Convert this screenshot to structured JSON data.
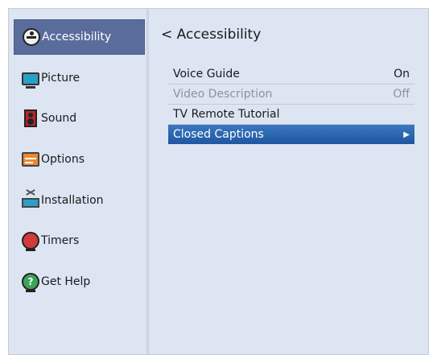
{
  "sidebar": {
    "items": [
      {
        "label": "Accessibility",
        "icon": "accessibility-icon",
        "active": true
      },
      {
        "label": "Picture",
        "icon": "picture-icon",
        "active": false
      },
      {
        "label": "Sound",
        "icon": "sound-icon",
        "active": false
      },
      {
        "label": "Options",
        "icon": "options-icon",
        "active": false
      },
      {
        "label": "Installation",
        "icon": "installation-icon",
        "active": false
      },
      {
        "label": "Timers",
        "icon": "timers-icon",
        "active": false
      },
      {
        "label": "Get Help",
        "icon": "help-icon",
        "active": false
      }
    ]
  },
  "main": {
    "back_glyph": "<",
    "title": "Accessibility",
    "menu": [
      {
        "label": "Voice Guide",
        "value": "On",
        "state": "normal"
      },
      {
        "label": "Video Description",
        "value": "Off",
        "state": "disabled"
      },
      {
        "label": "TV Remote Tutorial",
        "value": "",
        "state": "normal"
      },
      {
        "label": "Closed Captions",
        "value": "",
        "state": "selected",
        "arrow": "▶"
      }
    ]
  },
  "colors": {
    "background": "#dde5f3",
    "sidebar_active": "#5a6c9c",
    "selection": "#2c63a8"
  }
}
